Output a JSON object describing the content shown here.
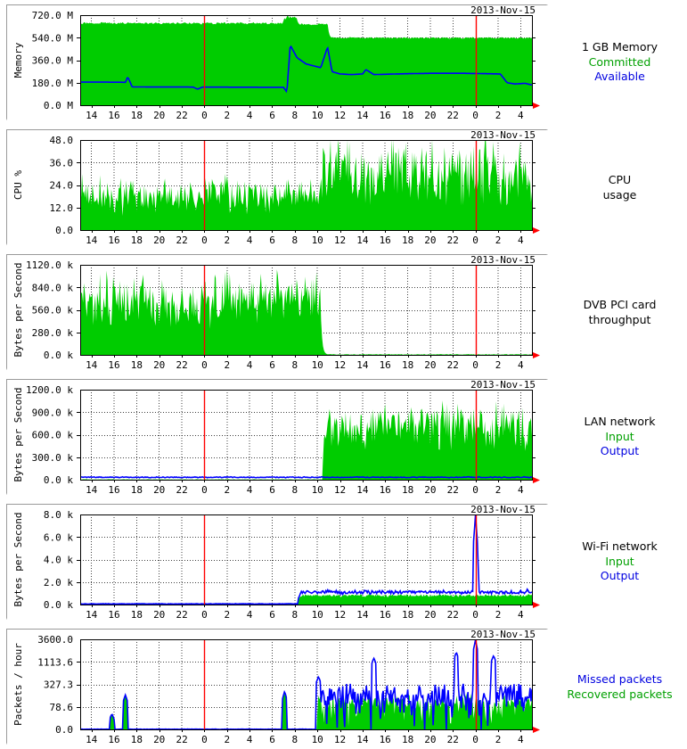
{
  "page": {
    "title": "System monitoring graphs",
    "background_color": "#ffffff",
    "panel_count": 6
  },
  "style": {
    "area_green": "#00cc00",
    "line_blue": "#0000ff",
    "line_dark_green": "#008000",
    "marker_red": "#ff0000",
    "grid_dotted": "#404040",
    "grid_solid": "#000000",
    "axis_black": "#000000",
    "frame_gray": "#9a9a9a",
    "text_black": "#000000"
  },
  "common": {
    "date_stamp": "2013-Nov-15",
    "x_tick_labels": [
      "14",
      "16",
      "18",
      "20",
      "22",
      "0",
      "2",
      "4",
      "6",
      "8",
      "10",
      "12",
      "14",
      "16",
      "18",
      "20",
      "22",
      "0",
      "2",
      "4"
    ],
    "x_label_start_hour": 14,
    "x_tick_step_hours": 2,
    "day_boundary_labels": [
      "0",
      "0"
    ]
  },
  "panels": [
    {
      "id": "memory",
      "ylabel": "Memory",
      "date_stamp": "2013-Nov-15",
      "y_ticks": [
        "0.0 M",
        "180.0 M",
        "360.0 M",
        "540.0 M",
        "720.0 M"
      ],
      "legend": [
        {
          "text": "1 GB Memory",
          "color": "#000000"
        },
        {
          "text": "Committed",
          "color": "#00a000"
        },
        {
          "text": "Available",
          "color": "#0000e0"
        }
      ],
      "chart_data": {
        "type": "area",
        "title": "1 GB Memory",
        "xlabel": "",
        "ylabel": "Memory",
        "ylim": [
          0,
          720
        ],
        "yticks": [
          0,
          180,
          360,
          540,
          720
        ],
        "ytick_labels": [
          "0.0 M",
          "180.0 M",
          "360.0 M",
          "540.0 M",
          "720.0 M"
        ],
        "xlim_hours": [
          13,
          53
        ],
        "grid": true,
        "legend_position": "right",
        "units": "MB",
        "series": [
          {
            "name": "Committed",
            "kind": "area",
            "color": "#00cc00",
            "segments": [
              {
                "from_hour": 13,
                "to_hour": 31.0,
                "level": 655,
                "noise": 8
              },
              {
                "from_hour": 31.0,
                "to_hour": 32.2,
                "level": 700,
                "noise": 14
              },
              {
                "from_hour": 32.2,
                "to_hour": 35.0,
                "level": 645,
                "noise": 8
              },
              {
                "from_hour": 35.0,
                "to_hour": 53,
                "level": 538,
                "noise": 6
              }
            ]
          },
          {
            "name": "Available",
            "kind": "line",
            "color": "#0000ff",
            "points_hour_value": [
              [
                13,
                185
              ],
              [
                16.5,
                184
              ],
              [
                17.0,
                183
              ],
              [
                17.2,
                226
              ],
              [
                17.4,
                190
              ],
              [
                17.6,
                146
              ],
              [
                23.0,
                145
              ],
              [
                23.4,
                128
              ],
              [
                23.8,
                145
              ],
              [
                31.0,
                143
              ],
              [
                31.3,
                105
              ],
              [
                31.6,
                480
              ],
              [
                32.2,
                380
              ],
              [
                33.0,
                330
              ],
              [
                34.3,
                300
              ],
              [
                34.9,
                465
              ],
              [
                35.3,
                268
              ],
              [
                36.0,
                250
              ],
              [
                37.0,
                245
              ],
              [
                38.0,
                250
              ],
              [
                38.3,
                285
              ],
              [
                39.0,
                245
              ],
              [
                41.0,
                250
              ],
              [
                42.0,
                252
              ],
              [
                44.0,
                255
              ],
              [
                47.0,
                255
              ],
              [
                49.0,
                252
              ],
              [
                50.2,
                250
              ],
              [
                50.8,
                180
              ],
              [
                51.5,
                170
              ],
              [
                52.4,
                175
              ],
              [
                53,
                162
              ]
            ]
          }
        ]
      }
    },
    {
      "id": "cpu",
      "ylabel": "CPU %",
      "date_stamp": "2013-Nov-15",
      "y_ticks": [
        "0.0",
        "12.0",
        "24.0",
        "36.0",
        "48.0"
      ],
      "legend": [
        {
          "text": "CPU",
          "color": "#000000"
        },
        {
          "text": "usage",
          "color": "#000000"
        }
      ],
      "chart_data": {
        "type": "area",
        "title": "CPU usage",
        "xlabel": "",
        "ylabel": "CPU %",
        "ylim": [
          0,
          48
        ],
        "yticks": [
          0,
          12,
          24,
          36,
          48
        ],
        "ytick_labels": [
          "0.0",
          "12.0",
          "24.0",
          "36.0",
          "48.0"
        ],
        "xlim_hours": [
          13,
          53
        ],
        "grid": true,
        "legend_position": "right",
        "units": "percent",
        "series": [
          {
            "name": "CPU usage",
            "kind": "area",
            "color": "#00cc00",
            "segments": [
              {
                "from_hour": 13,
                "to_hour": 34.5,
                "level": 19,
                "noise": 9,
                "seed": 11
              },
              {
                "from_hour": 34.5,
                "to_hour": 53,
                "level": 31,
                "noise": 17,
                "seed": 23
              }
            ]
          }
        ]
      }
    },
    {
      "id": "dvb",
      "ylabel": "Bytes per Second",
      "date_stamp": "2013-Nov-15",
      "y_ticks": [
        "0.0 k",
        "280.0 k",
        "560.0 k",
        "840.0 k",
        "1120.0 k"
      ],
      "legend": [
        {
          "text": "DVB PCI card",
          "color": "#000000"
        },
        {
          "text": "throughput",
          "color": "#000000"
        }
      ],
      "chart_data": {
        "type": "area",
        "title": "DVB PCI card throughput",
        "xlabel": "",
        "ylabel": "Bytes per Second",
        "ylim": [
          0,
          1120
        ],
        "yticks": [
          0,
          280,
          560,
          840,
          1120
        ],
        "ytick_labels": [
          "0.0 k",
          "280.0 k",
          "560.0 k",
          "840.0 k",
          "1120.0 k"
        ],
        "xlim_hours": [
          13,
          53
        ],
        "grid": true,
        "legend_position": "right",
        "units": "kB/s",
        "series": [
          {
            "name": "DVB throughput",
            "kind": "area",
            "color": "#00cc00",
            "segments": [
              {
                "from_hour": 13,
                "to_hour": 34.3,
                "level": 690,
                "noise": 290,
                "seed": 5
              },
              {
                "from_hour": 34.3,
                "to_hour": 53,
                "level": 6,
                "noise": 4,
                "seed": 7
              }
            ]
          }
        ]
      }
    },
    {
      "id": "lan",
      "ylabel": "Bytes per Second",
      "date_stamp": "2013-Nov-15",
      "y_ticks": [
        "0.0 k",
        "300.0 k",
        "600.0 k",
        "900.0 k",
        "1200.0 k"
      ],
      "legend": [
        {
          "text": "LAN network",
          "color": "#000000"
        },
        {
          "text": "Input",
          "color": "#00a000"
        },
        {
          "text": "Output",
          "color": "#0000e0"
        }
      ],
      "chart_data": {
        "type": "area",
        "title": "LAN network",
        "xlabel": "",
        "ylabel": "Bytes per Second",
        "ylim": [
          0,
          1200
        ],
        "yticks": [
          0,
          300,
          600,
          900,
          1200
        ],
        "ytick_labels": [
          "0.0 k",
          "300.0 k",
          "600.0 k",
          "900.0 k",
          "1200.0 k"
        ],
        "xlim_hours": [
          13,
          53
        ],
        "grid": true,
        "legend_position": "right",
        "units": "kB/s",
        "series": [
          {
            "name": "Input",
            "kind": "area",
            "color": "#00cc00",
            "segments": [
              {
                "from_hour": 13,
                "to_hour": 34.5,
                "level": 4,
                "noise": 3,
                "seed": 3
              },
              {
                "from_hour": 34.5,
                "to_hour": 53,
                "level": 720,
                "noise": 280,
                "seed": 17
              }
            ]
          },
          {
            "name": "Output",
            "kind": "line",
            "color": "#0000ff",
            "segments": [
              {
                "from_hour": 13,
                "to_hour": 53,
                "level": 32,
                "noise": 6,
                "seed": 9
              }
            ]
          }
        ]
      }
    },
    {
      "id": "wifi",
      "ylabel": "Bytes per Second",
      "date_stamp": "2013-Nov-15",
      "y_ticks": [
        "0.0 k",
        "2.0 k",
        "4.0 k",
        "6.0 k",
        "8.0 k"
      ],
      "legend": [
        {
          "text": "Wi-Fi network",
          "color": "#000000"
        },
        {
          "text": "Input",
          "color": "#00a000"
        },
        {
          "text": "Output",
          "color": "#0000e0"
        }
      ],
      "chart_data": {
        "type": "area",
        "title": "Wi-Fi network",
        "xlabel": "",
        "ylabel": "Bytes per Second",
        "ylim": [
          0,
          8
        ],
        "yticks": [
          0,
          2,
          4,
          6,
          8
        ],
        "ytick_labels": [
          "0.0 k",
          "2.0 k",
          "4.0 k",
          "6.0 k",
          "8.0 k"
        ],
        "xlim_hours": [
          13,
          53
        ],
        "grid": true,
        "legend_position": "right",
        "units": "kB/s",
        "series": [
          {
            "name": "Input",
            "kind": "area",
            "color": "#00cc00",
            "segments": [
              {
                "from_hour": 13,
                "to_hour": 32.3,
                "level": 0.03,
                "noise": 0.02,
                "seed": 2
              },
              {
                "from_hour": 32.3,
                "to_hour": 53,
                "level": 0.8,
                "noise": 0.12,
                "seed": 13
              }
            ]
          },
          {
            "name": "Output",
            "kind": "line",
            "color": "#0000ff",
            "segments": [
              {
                "from_hour": 13,
                "to_hour": 32.3,
                "level": 0.06,
                "noise": 0.02,
                "seed": 4
              },
              {
                "from_hour": 32.3,
                "to_hour": 53,
                "level": 1.1,
                "noise": 0.16,
                "seed": 21
              }
            ],
            "spikes": [
              [
                48.0,
                7.95
              ],
              [
                48.1,
                4.3
              ],
              [
                52.6,
                1.4
              ]
            ]
          }
        ]
      }
    },
    {
      "id": "packets",
      "ylabel": "Packets / hour",
      "date_stamp": "2013-Nov-15",
      "y_ticks": [
        "0.0",
        "78.6",
        "327.3",
        "1113.6",
        "3600.0"
      ],
      "legend": [
        {
          "text": "Missed packets",
          "color": "#0000e0"
        },
        {
          "text": "Recovered packets",
          "color": "#00a000"
        }
      ],
      "chart_data": {
        "type": "area",
        "title": "Missed / recovered packets",
        "xlabel": "",
        "ylabel": "Packets / hour",
        "ylim": [
          0,
          3600
        ],
        "y_scale": "logarithmic-like",
        "yticks": [
          0,
          78.6,
          327.3,
          1113.6,
          3600
        ],
        "ytick_labels": [
          "0.0",
          "78.6",
          "327.3",
          "1113.6",
          "3600.0"
        ],
        "xlim_hours": [
          13,
          53
        ],
        "grid": true,
        "legend_position": "right",
        "units": "packets/hour",
        "series": [
          {
            "name": "Recovered packets",
            "kind": "area",
            "color": "#00cc00",
            "segments": [
              {
                "from_hour": 13,
                "to_hour": 34.0,
                "level": 0.5,
                "noise": 0.4,
                "seed": 6
              },
              {
                "from_hour": 34.0,
                "to_hour": 53,
                "level": 120,
                "noise": 100,
                "seed": 31
              }
            ],
            "spikes": [
              [
                15.8,
                52
              ],
              [
                17.0,
                200
              ],
              [
                31.1,
                230
              ]
            ]
          },
          {
            "name": "Missed packets",
            "kind": "line",
            "color": "#0000ff",
            "segments": [
              {
                "from_hour": 13,
                "to_hour": 34.0,
                "level": 0.6,
                "noise": 0.5,
                "seed": 8
              },
              {
                "from_hour": 34.0,
                "to_hour": 53,
                "level": 160,
                "noise": 160,
                "seed": 37
              }
            ],
            "spikes": [
              [
                15.8,
                55
              ],
              [
                17.0,
                210
              ],
              [
                31.1,
                250
              ],
              [
                34.1,
                600
              ],
              [
                39.0,
                1500
              ],
              [
                46.3,
                2200
              ],
              [
                48.0,
                3550
              ],
              [
                49.6,
                1800
              ]
            ]
          }
        ]
      }
    }
  ]
}
